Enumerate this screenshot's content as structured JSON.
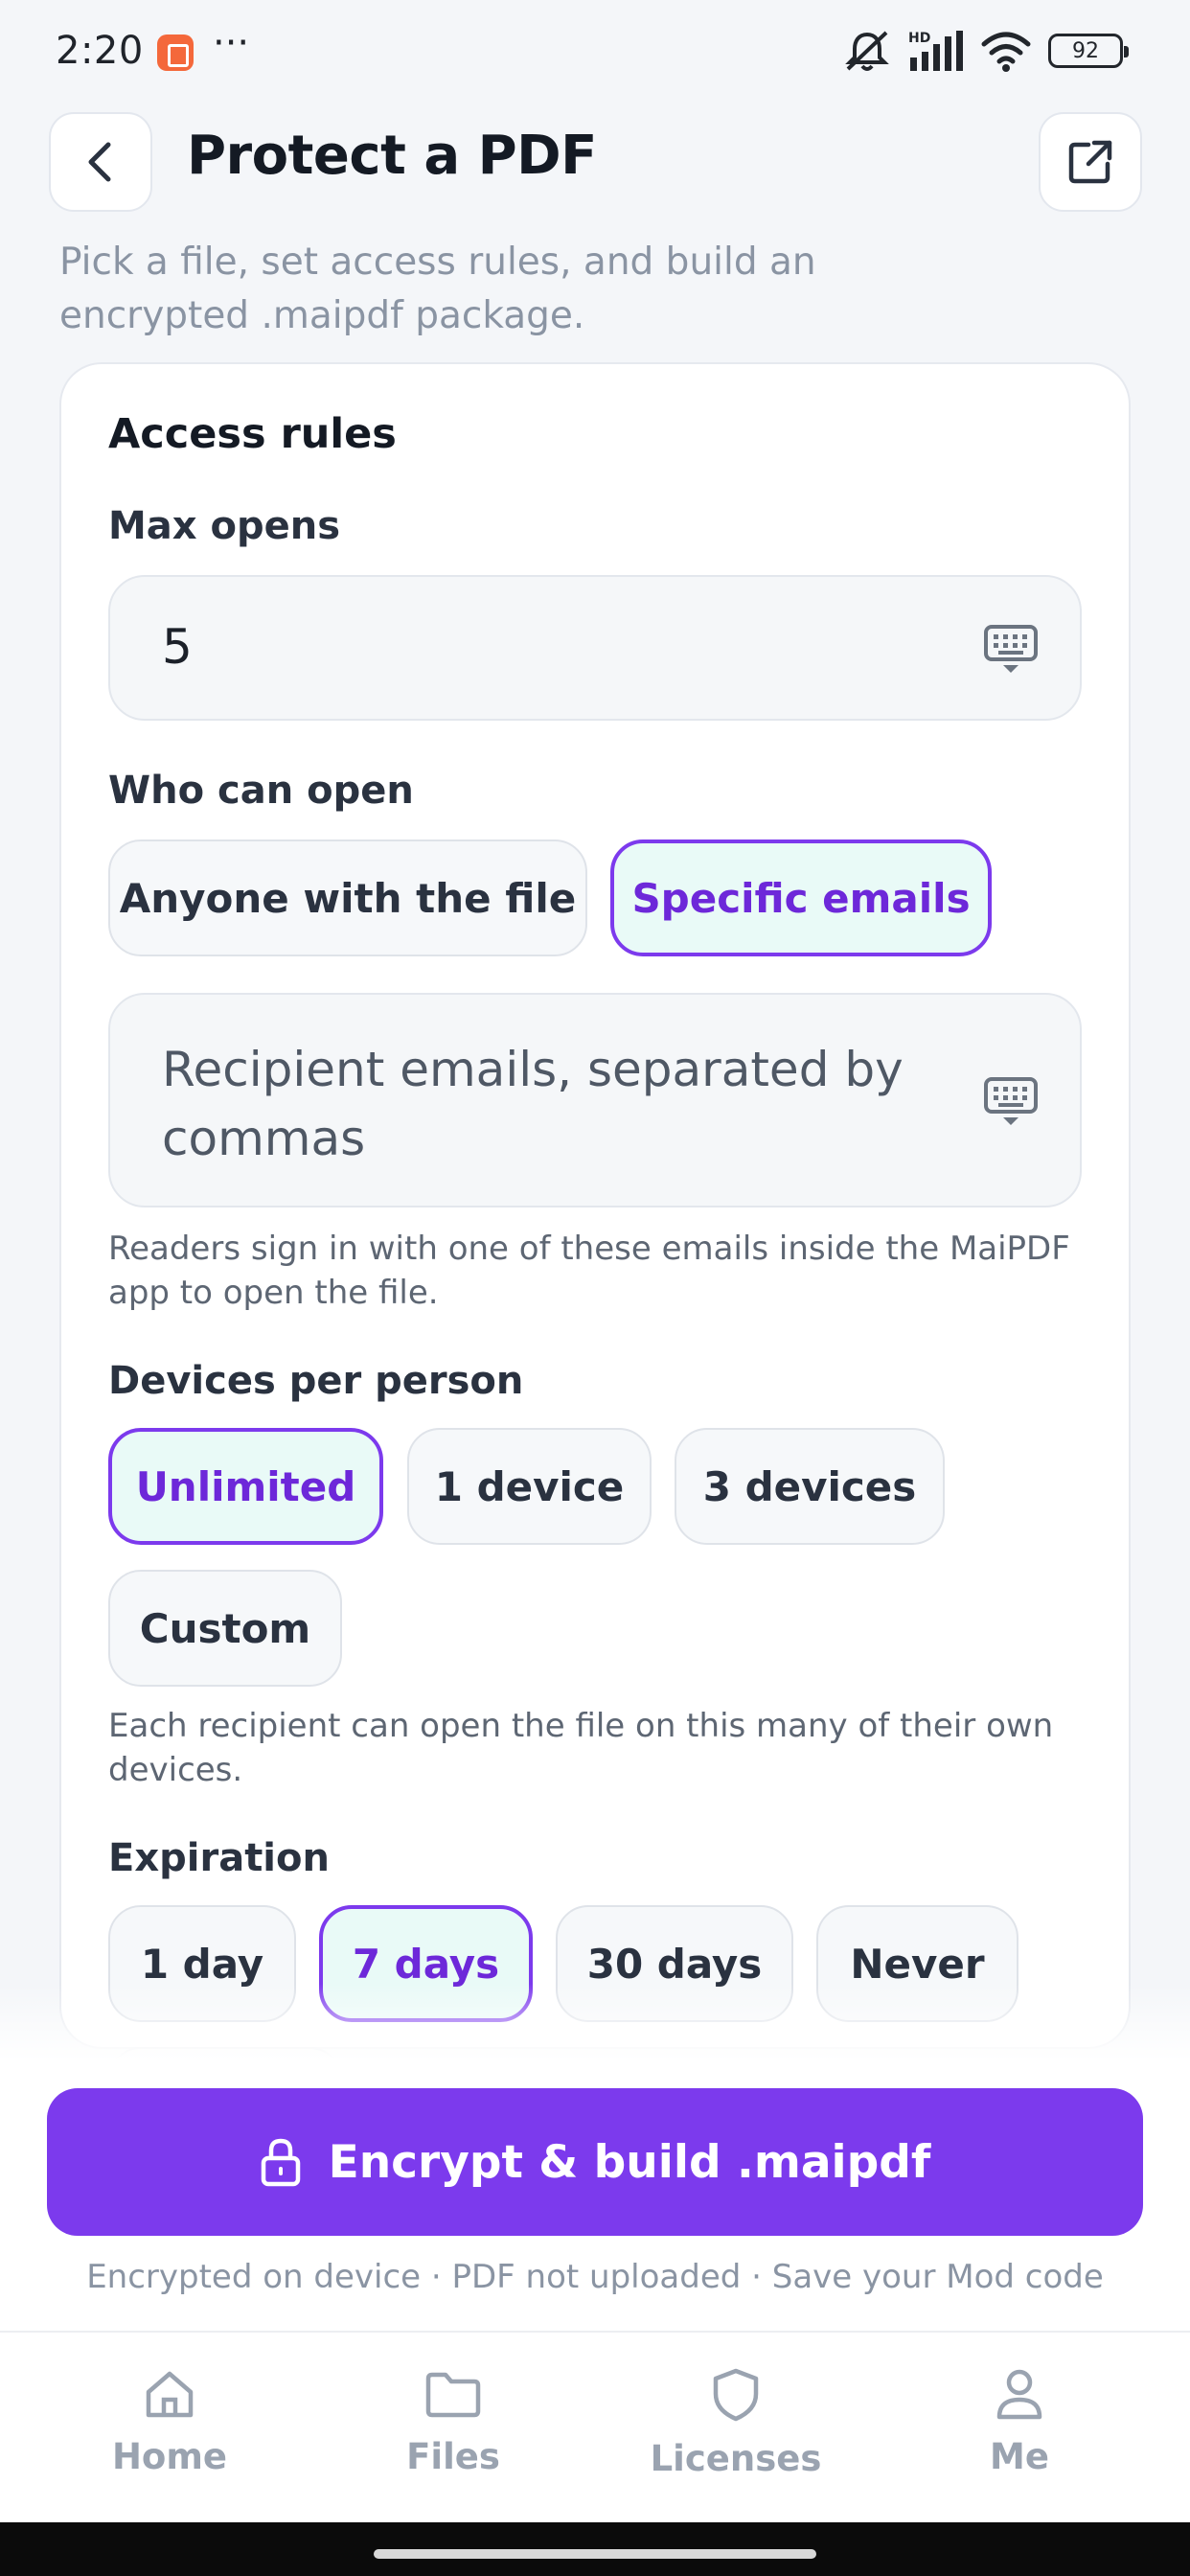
{
  "status_bar": {
    "time": "2:20",
    "dots": "···",
    "battery": "92",
    "network": "HD"
  },
  "header": {
    "title": "Protect a PDF",
    "subtitle": "Pick a file, set access rules, and build an encrypted .maipdf package."
  },
  "card": {
    "title": "Access rules",
    "max_opens": {
      "label": "Max opens",
      "value": "5"
    },
    "who_can_open": {
      "label": "Who can open",
      "options": [
        "Anyone with the file",
        "Specific emails"
      ],
      "selected": "Specific emails",
      "emails_placeholder": "Recipient emails, separated by commas",
      "helper": "Readers sign in with one of these emails inside the MaiPDF app to open the file."
    },
    "devices": {
      "label": "Devices per person",
      "options": [
        "Unlimited",
        "1 device",
        "3 devices",
        "Custom"
      ],
      "selected": "Unlimited",
      "helper": "Each recipient can open the file on this many of their own devices."
    },
    "expiration": {
      "label": "Expiration",
      "options": [
        "1 day",
        "7 days",
        "30 days",
        "Never"
      ],
      "selected": "7 days"
    }
  },
  "action": {
    "button_label": "Encrypt & build .maipdf",
    "footnote": "Encrypted on device · PDF not uploaded · Save your Mod code"
  },
  "tabs": [
    {
      "label": "Home",
      "icon": "home-icon"
    },
    {
      "label": "Files",
      "icon": "folder-icon"
    },
    {
      "label": "Licenses",
      "icon": "shield-icon"
    },
    {
      "label": "Me",
      "icon": "person-icon"
    }
  ],
  "colors": {
    "accent": "#7c3aed",
    "selected_chip_bg": "#e9faf7",
    "background": "#f4f6f9"
  }
}
